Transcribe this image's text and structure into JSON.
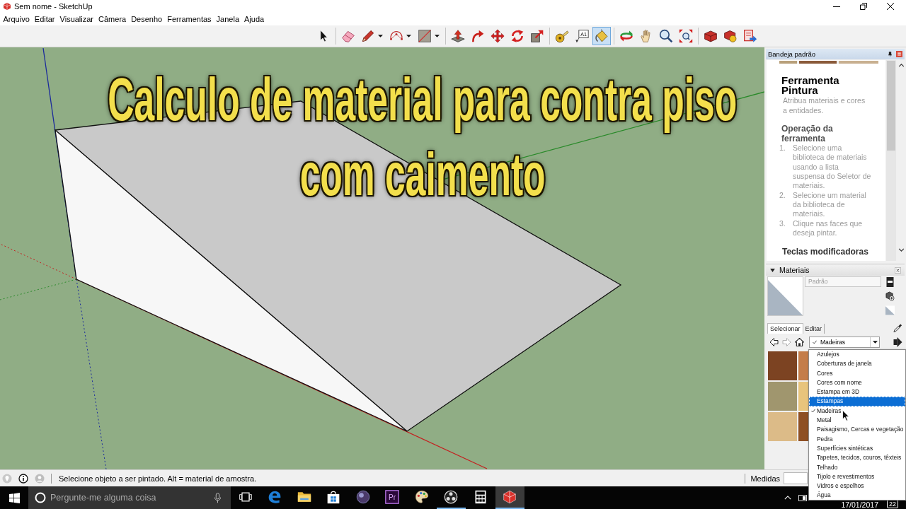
{
  "window": {
    "title": "Sem nome - SketchUp"
  },
  "menu": [
    "Arquivo",
    "Editar",
    "Visualizar",
    "Câmera",
    "Desenho",
    "Ferramentas",
    "Janela",
    "Ajuda"
  ],
  "toolbar": [
    [
      {
        "selected": false,
        "menu": false
      }
    ],
    [
      {
        "selected": false,
        "menu": false
      },
      {
        "selected": false,
        "menu": true
      },
      {
        "selected": false,
        "menu": true
      },
      {
        "selected": false,
        "menu": true
      }
    ],
    [
      {
        "selected": false,
        "menu": false
      },
      {
        "selected": false,
        "menu": false
      },
      {
        "selected": false,
        "menu": false
      },
      {
        "selected": false,
        "menu": false
      },
      {
        "selected": false,
        "menu": false
      }
    ],
    [
      {
        "selected": false,
        "menu": false
      },
      {
        "selected": false,
        "menu": false,
        "label": "A1"
      },
      {
        "selected": true,
        "menu": false
      }
    ],
    [
      {
        "selected": false,
        "menu": false
      },
      {
        "selected": false,
        "menu": false
      },
      {
        "selected": false,
        "menu": false
      },
      {
        "selected": false,
        "menu": false
      }
    ],
    [
      {
        "selected": false,
        "menu": false
      },
      {
        "selected": false,
        "menu": false
      },
      {
        "selected": false,
        "menu": false
      }
    ]
  ],
  "viewport": {
    "title_lines": [
      "Calculo de material para contra piso",
      "com caimento"
    ]
  },
  "tray": {
    "title": "Bandeja padrão",
    "instructor": {
      "heading": "Ferramenta Pintura",
      "summary": "Atribua materiais e cores a entidades.",
      "section": "Operação da ferramenta",
      "steps": [
        {
          "number": "1.",
          "text": "Selecione uma biblioteca de materiais usando a lista suspensa do Seletor de materiais."
        },
        {
          "number": "2.",
          "text": "Selecione um material da biblioteca de materiais."
        },
        {
          "number": "3.",
          "text": "Clique nas faces que deseja pintar."
        }
      ],
      "next_section": "Teclas modificadoras"
    },
    "materials": {
      "title": "Materiais",
      "name_field": {
        "value": "Padrão",
        "disabled": true
      },
      "tabs": [
        {
          "label": "Selecionar",
          "selected": true
        },
        {
          "label": "Editar",
          "selected": false
        }
      ],
      "nav_buttons": [
        {
          "disabled": false
        },
        {
          "disabled": true
        },
        {
          "disabled": false
        }
      ],
      "library": {
        "value": "Madeiras",
        "checked": true
      },
      "swatches": [
        {
          "color": "#7c4322"
        },
        {
          "color": "#c47d4a"
        },
        {
          "color": "#a0966e"
        },
        {
          "color": "#e8c47c"
        },
        {
          "color": "#dcbb88"
        },
        {
          "color": "#8e5024"
        }
      ],
      "library_options": [
        {
          "label": "Azulejos",
          "selected": false,
          "checked": false
        },
        {
          "label": "Coberturas de janela",
          "selected": false,
          "checked": false
        },
        {
          "label": "Cores",
          "selected": false,
          "checked": false
        },
        {
          "label": "Cores com nome",
          "selected": false,
          "checked": false
        },
        {
          "label": "Estampa em 3D",
          "selected": false,
          "checked": false
        },
        {
          "label": "Estampas",
          "selected": true,
          "checked": false
        },
        {
          "label": "Madeiras",
          "selected": false,
          "checked": true
        },
        {
          "label": "Metal",
          "selected": false,
          "checked": false
        },
        {
          "label": "Paisagismo, Cercas e vegetação",
          "selected": false,
          "checked": false
        },
        {
          "label": "Pedra",
          "selected": false,
          "checked": false
        },
        {
          "label": "Superfícies sintéticas",
          "selected": false,
          "checked": false
        },
        {
          "label": "Tapetes, tecidos, couros, têxteis",
          "selected": false,
          "checked": false
        },
        {
          "label": "Telhado",
          "selected": false,
          "checked": false
        },
        {
          "label": "Tijolo e revestimentos",
          "selected": false,
          "checked": false
        },
        {
          "label": "Vidros e espelhos",
          "selected": false,
          "checked": false
        },
        {
          "label": "Água",
          "selected": false,
          "checked": false
        }
      ]
    }
  },
  "status_bar": {
    "message": "Selecione objeto a ser pintado. Alt = material de amostra.",
    "measurements_label": "Medidas"
  },
  "taskbar": {
    "search_placeholder": "Pergunte-me alguma coisa",
    "apps": [
      {
        "running": false,
        "selected": false
      },
      {
        "running": false,
        "selected": false
      },
      {
        "running": false,
        "selected": false
      },
      {
        "running": false,
        "selected": false
      },
      {
        "running": false,
        "selected": false
      },
      {
        "running": false,
        "selected": false,
        "label": "Pr"
      },
      {
        "running": false,
        "selected": false
      },
      {
        "running": true,
        "selected": false
      },
      {
        "running": false,
        "selected": false
      },
      {
        "running": true,
        "selected": true
      }
    ],
    "date": "17/01/2017",
    "notifications": "22"
  }
}
